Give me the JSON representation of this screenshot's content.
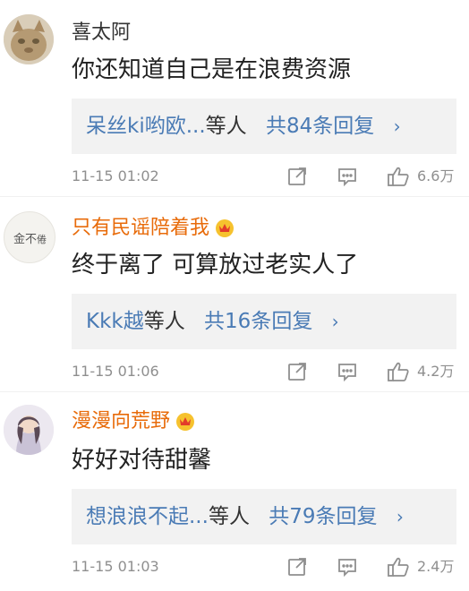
{
  "comments": [
    {
      "user": "喜太阿",
      "vip": false,
      "text": "你还知道自己是在浪费资源",
      "reply_users": "呆丝ki哟欧...",
      "reply_suffix": "等人",
      "reply_count": "共84条回复",
      "time": "11-15 01:02",
      "likes": "6.6万"
    },
    {
      "user": "只有民谣陪着我",
      "vip": true,
      "text": "终于离了 可算放过老实人了",
      "reply_users": "Kkk越",
      "reply_suffix": "等人",
      "reply_count": "共16条回复",
      "time": "11-15 01:06",
      "likes": "4.2万"
    },
    {
      "user": "漫漫向荒野",
      "vip": true,
      "text": "好好对待甜馨",
      "reply_users": "想浪浪不起...",
      "reply_suffix": "等人",
      "reply_count": "共79条回复",
      "time": "11-15 01:03",
      "likes": "2.4万"
    }
  ],
  "chevron": "›",
  "icons": {
    "share": "share-icon",
    "comment": "comment-icon",
    "like": "thumbs-up-icon",
    "vip": "vip-crown-badge-icon"
  },
  "colors": {
    "vip_name": "#e86b0a",
    "reply_link": "#4a7bb5",
    "meta": "#8f8f8f"
  }
}
